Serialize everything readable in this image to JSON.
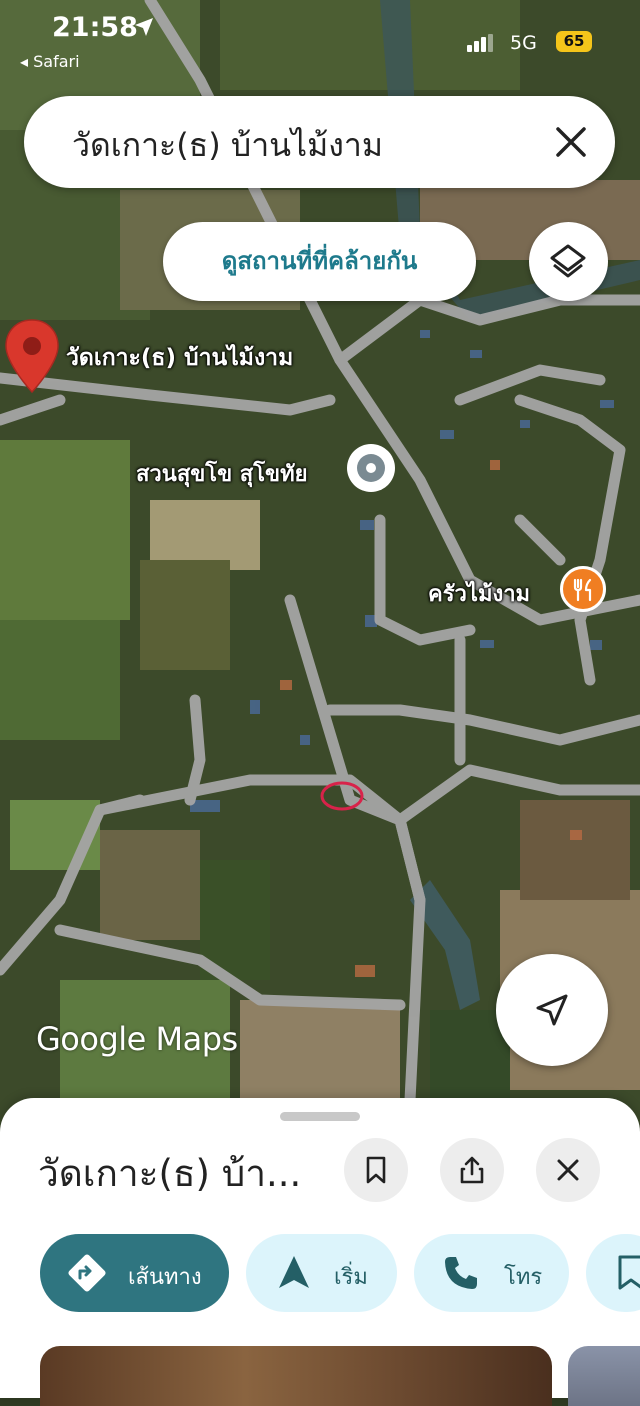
{
  "status_bar": {
    "time": "21:58",
    "back_app": "◂ Safari",
    "network": "5G",
    "battery": "65"
  },
  "search": {
    "query": "วัดเกาะ(ธ) บ้านไม้งาม"
  },
  "similar_button": {
    "label": "ดูสถานที่ที่คล้ายกัน"
  },
  "map": {
    "pin_label": "วัดเกาะ(ธ) บ้านไม้งาม",
    "park_label": "สวนสุขโข สุโขทัย",
    "restaurant_label": "ครัวไม้งาม",
    "watermark": "Google Maps"
  },
  "sheet": {
    "title": "วัดเกาะ(ธ) บ้า...",
    "chips": [
      {
        "label": "เส้นทาง",
        "icon": "directions-icon"
      },
      {
        "label": "เริ่ม",
        "icon": "navigation-arrow-icon"
      },
      {
        "label": "โทร",
        "icon": "phone-icon"
      }
    ]
  },
  "colors": {
    "accent": "#2f7580",
    "chip_bg": "#dcf4fb",
    "pin_red": "#d9372c",
    "restaurant": "#f07e22"
  }
}
